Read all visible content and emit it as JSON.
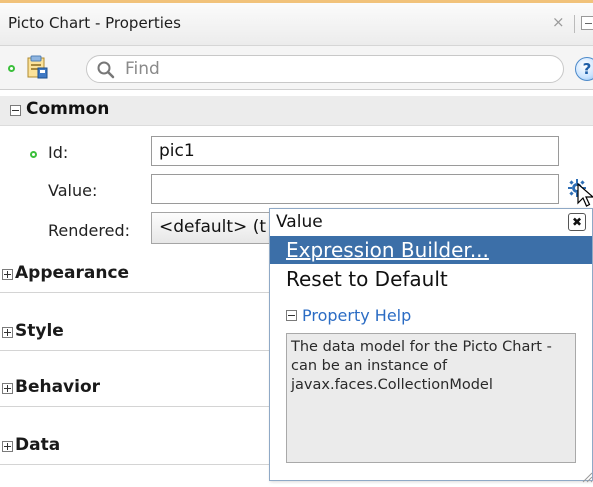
{
  "window": {
    "title": "Picto Chart - Properties",
    "close_glyph": "×"
  },
  "toolbar": {
    "search_placeholder": "Find",
    "help_glyph": "?"
  },
  "sections": {
    "common": "Common",
    "appearance": "Appearance",
    "style": "Style",
    "behavior": "Behavior",
    "data": "Data"
  },
  "properties": {
    "id": {
      "label": "Id:",
      "value": "pic1"
    },
    "value": {
      "label": "Value:",
      "value": ""
    },
    "rendered": {
      "label": "Rendered:",
      "value": "<default> (t"
    }
  },
  "popup": {
    "title": "Value",
    "close_glyph": "✖",
    "menu": [
      {
        "label": "Expression Builder...",
        "selected": true
      },
      {
        "label": "Reset to Default",
        "selected": false
      }
    ],
    "help_heading": "Property Help",
    "help_text": "The data model for the Picto Chart - can be an instance of javax.faces.CollectionModel"
  },
  "colors": {
    "selection": "#3c6fa8",
    "help_link": "#2b6cc4",
    "indicator_green": "#3bbf3b"
  }
}
